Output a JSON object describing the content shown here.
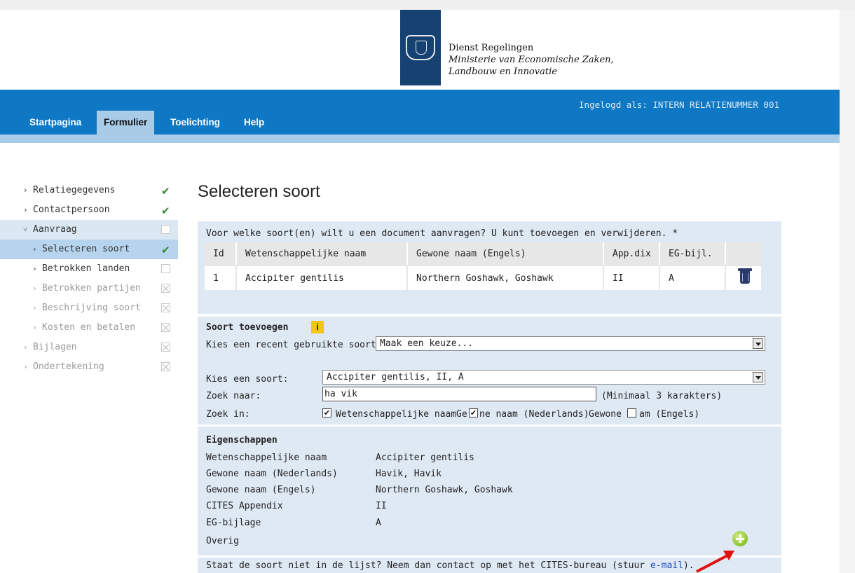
{
  "header": {
    "org_line1": "Dienst Regelingen",
    "org_line2": "Ministerie van Economische Zaken,",
    "org_line3": "Landbouw en Innovatie"
  },
  "nav": {
    "login_text": "Ingelogd als: INTERN RELATIENUMMER 001",
    "tabs": [
      "Startpagina",
      "Formulier",
      "Toelichting",
      "Help"
    ],
    "active_tab": "Formulier"
  },
  "sidebar": {
    "items": [
      {
        "label": "Relatiegegevens",
        "status": "checked"
      },
      {
        "label": "Contactpersoon",
        "status": "checked"
      },
      {
        "label": "Aanvraag",
        "status": "empty"
      },
      {
        "label": "Selecteren soort",
        "status": "checked"
      },
      {
        "label": "Betrokken landen",
        "status": "empty"
      },
      {
        "label": "Betrokken partijen",
        "status": "disabled"
      },
      {
        "label": "Beschrijving soort",
        "status": "disabled"
      },
      {
        "label": "Kosten en betalen",
        "status": "disabled"
      },
      {
        "label": "Bijlagen",
        "status": "disabled"
      },
      {
        "label": "Ondertekening",
        "status": "disabled"
      }
    ]
  },
  "main": {
    "title": "Selecteren soort",
    "intro": "Voor welke soort(en) wilt u een document aanvragen? U kunt toevoegen en verwijderen. *",
    "table": {
      "headers": [
        "Id",
        "Wetenschappelijke naam",
        "Gewone naam (Engels)",
        "App.dix",
        "EG-bijl."
      ],
      "rows": [
        [
          "1",
          "Accipiter gentilis",
          "Northern Goshawk, Goshawk",
          "II",
          "A"
        ]
      ]
    },
    "add": {
      "heading": "Soort toevoegen",
      "info_label": "i",
      "recent_label": "Kies een recent gebruikte soort:",
      "recent_value": "Maak een keuze...",
      "soort_label": "Kies een soort:",
      "soort_value": "Accipiter gentilis, II, A",
      "zoek_label": "Zoek naar:",
      "zoek_value": "ha vik",
      "zoek_hint": "(Minimaal 3 karakters)",
      "zoekin_label": "Zoek in:",
      "opt1": "Wetenschappelijke naam",
      "opt2_a": "Ge",
      "opt2_b": "ne naam (Nederlands)",
      "opt3_a": "Gewone",
      "opt3_b": "am (Engels)"
    },
    "props": {
      "heading": "Eigenschappen",
      "rows": [
        {
          "label": "Wetenschappelijke naam",
          "value": "Accipiter gentilis"
        },
        {
          "label": "Gewone naam (Nederlands)",
          "value": "Havik, Havik"
        },
        {
          "label": "Gewone naam (Engels)",
          "value": "Northern Goshawk, Goshawk"
        },
        {
          "label": "CITES Appendix",
          "value": "II"
        },
        {
          "label": "EG-bijlage",
          "value": "A"
        },
        {
          "label": "Overig",
          "value": ""
        }
      ]
    },
    "footer": {
      "text": "Staat de soort niet in de lijst? Neem dan contact op met het CITES-bureau (stuur ",
      "link": "e-mail",
      "end": ")."
    }
  },
  "colors": {
    "nav_blue": "#0f78c5",
    "nav_light": "#a8cbe8",
    "panel": "#dfe9f4",
    "logo": "#154273"
  }
}
